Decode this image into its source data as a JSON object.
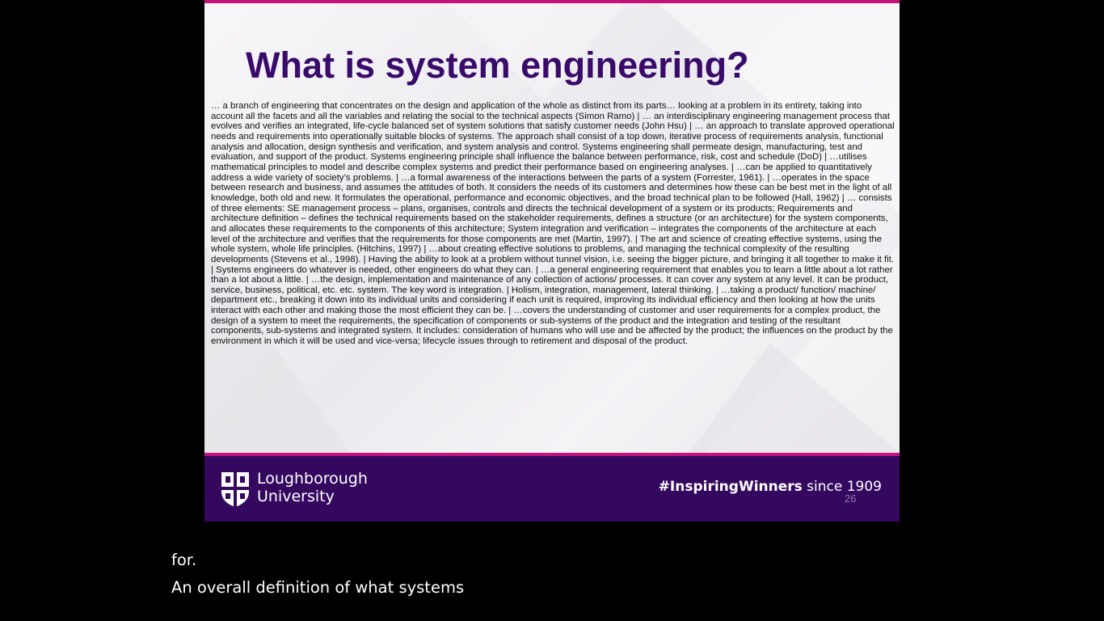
{
  "slide": {
    "title": "What is system engineering?",
    "body": "… a branch of engineering that concentrates on the design and application of the whole as distinct from its parts… looking at a problem in its entirety, taking into account all the facets and all the variables and relating the social to the technical aspects (Simon Ramo) | … an interdisciplinary engineering management process that evolves and verifies an integrated, life-cycle balanced set of system solutions that satisfy customer needs (John Hsu) | … an approach to translate approved operational needs and requirements into operationally suitable blocks of systems. The approach shall consist of a top down, iterative process of requirements analysis, functional analysis and allocation, design synthesis and verification, and system analysis and control. Systems engineering shall permeate design, manufacturing, test and evaluation, and support of the product. Systems engineering principle shall influence the balance between performance, risk, cost and schedule (DoD) | …utilises mathematical principles to model and describe complex systems and predict their performance based on engineering analyses. | …can be applied to quantitatively address a wide variety of society’s problems. | …a formal awareness of the interactions between the parts of a system (Forrester, 1961). | …operates in the space between research and business, and assumes the attitudes of both. It considers the needs of its customers and determines how these can be best met in the light of all knowledge, both old and new. It formulates the operational, performance and economic objectives, and the broad technical plan to be followed (Hall, 1962) | … consists of three elements: SE management process – plans, organises, controls and directs the technical development of a system or its products; Requirements and architecture definition – defines the technical requirements based on the stakeholder requirements, defines a structure (or an architecture) for the system components, and allocates these requirements to the components of this architecture; System integration and verification – integrates the components of the architecture at each level of the architecture and verifies that the requirements for those components are met (Martin, 1997). | The art and science of creating effective systems, using the whole system, whole life principles. (Hitchins, 1997) | …about creating effective solutions to problems, and managing the technical complexity of the resulting developments (Stevens et al., 1998). | Having the ability to look at a problem without tunnel vision, i.e. seeing the bigger picture, and bringing it all together to make it fit. | Systems engineers do whatever is needed, other engineers do what they can. | …a general engineering requirement that enables you to learn a little about a lot rather than a lot about a little. | …the design, implementation and maintenance of any collection of actions/ processes. It can cover any system at any level. It can be product, service, business, political, etc. etc. system. The key word is integration. | Holism, integration, management, lateral thinking. | …taking a product/ function/ machine/ department etc., breaking it down into its individual units and considering if each unit is required, improving its individual efficiency and then looking at how the units interact with each other and making those the most efficient they can be. | …covers the understanding of customer and user requirements for a complex product, the design of a system to meet the requirements, the specification of components or sub-systems of the product and the integration and testing of the resultant components, sub-systems and integrated system. It includes: consideration of humans who will use and be affected by the product; the influences on the product by the environment in which it will be used and vice-versa; lifecycle issues through to retirement and disposal of the product.",
    "footer": {
      "logo_line1": "Loughborough",
      "logo_line2": "University",
      "tagline_bold": "#InspiringWinners",
      "tagline_rest": " since 1909",
      "slide_number": "26"
    },
    "colors": {
      "accent": "#c4127a",
      "brand_purple": "#35085f",
      "title": "#3a0a6b"
    }
  },
  "captions": {
    "line1": "for.",
    "line2": "An overall definition of what systems"
  }
}
